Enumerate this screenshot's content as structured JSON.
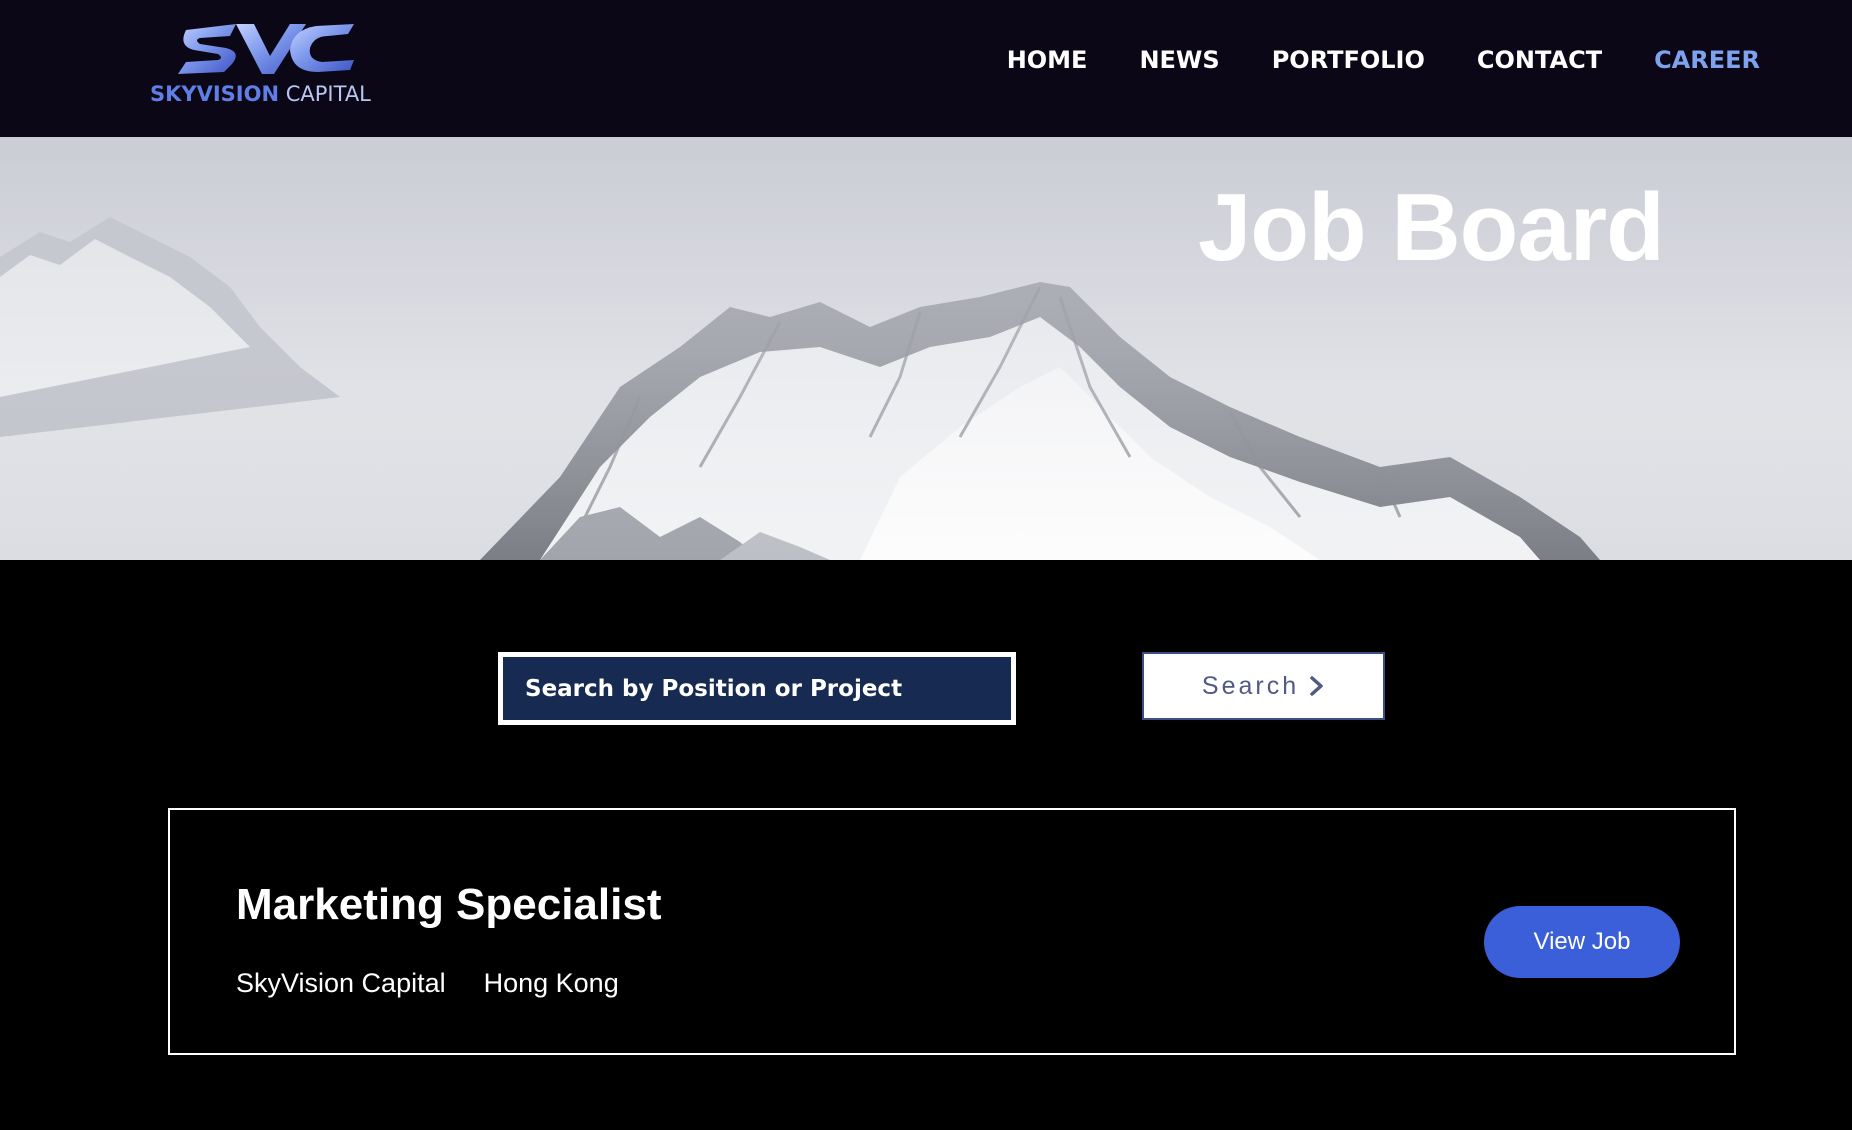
{
  "header": {
    "logo": {
      "mark_letters": "SVC",
      "brand_bold": "SKYVISION",
      "brand_light": "CAPITAL"
    },
    "nav": [
      {
        "label": "HOME",
        "active": false
      },
      {
        "label": "NEWS",
        "active": false
      },
      {
        "label": "PORTFOLIO",
        "active": false
      },
      {
        "label": "CONTACT",
        "active": false
      },
      {
        "label": "CAREER",
        "active": true
      }
    ],
    "accent_color": "#7ea2ee"
  },
  "hero": {
    "title": "Job Board",
    "background": "snowy-mountain-photo"
  },
  "search": {
    "placeholder": "Search by Position or Project",
    "value": "",
    "button_label": "Search",
    "button_icon": "chevron-right-icon"
  },
  "jobs": [
    {
      "title": "Marketing Specialist",
      "company": "SkyVision Capital",
      "location": "Hong Kong",
      "action_label": "View Job",
      "action_color": "#3a5fd9"
    }
  ]
}
